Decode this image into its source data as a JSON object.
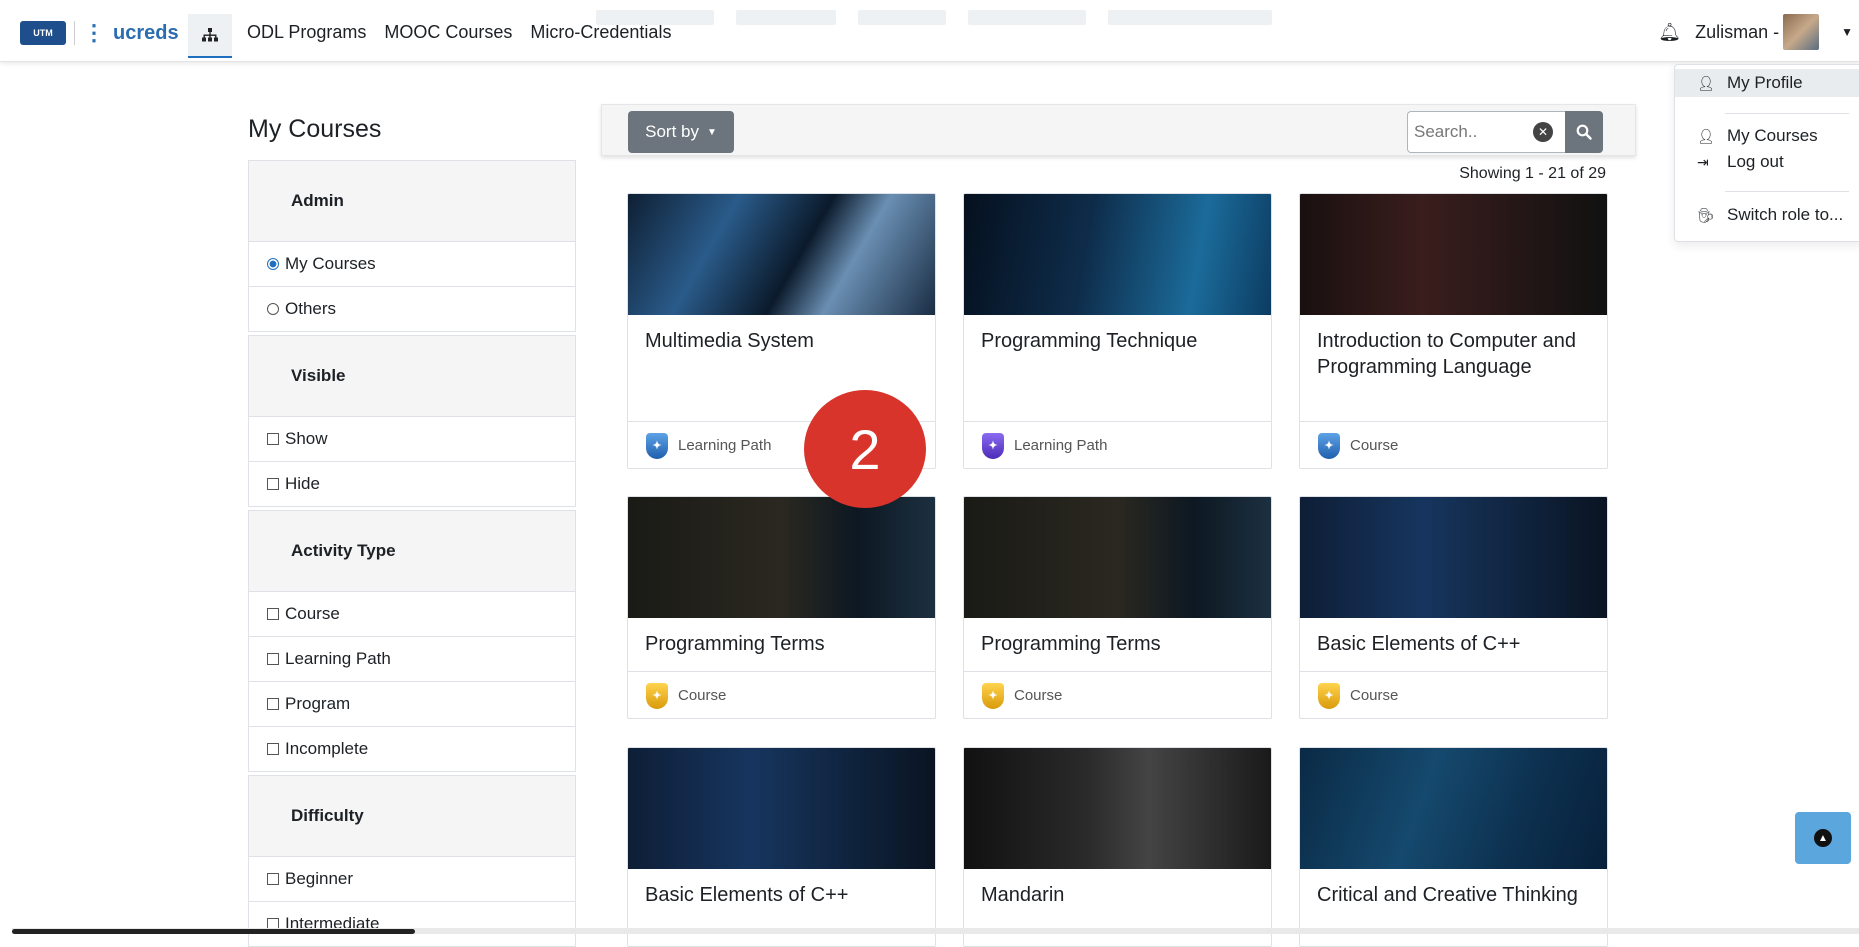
{
  "brand": {
    "badge": "UTM",
    "name": "ucreds"
  },
  "nav": {
    "links": [
      "ODL Programs",
      "MOOC Courses",
      "Micro-Credentials"
    ]
  },
  "user": {
    "name": "Zulisman -"
  },
  "user_menu": {
    "items": [
      {
        "label": "My Profile",
        "icon": "user-icon"
      },
      {
        "label": "My Courses",
        "icon": "user-icon"
      },
      {
        "label": "Log out",
        "icon": "sign-out-icon"
      },
      {
        "label": "Switch role to...",
        "icon": "user-secret-icon"
      }
    ]
  },
  "page": {
    "title": "My Courses"
  },
  "filters": {
    "admin": {
      "title": "Admin",
      "options": [
        "My Courses",
        "Others"
      ]
    },
    "visible": {
      "title": "Visible",
      "options": [
        "Show",
        "Hide"
      ]
    },
    "activity": {
      "title": "Activity Type",
      "options": [
        "Course",
        "Learning Path",
        "Program",
        "Incomplete"
      ]
    },
    "difficulty": {
      "title": "Difficulty",
      "options": [
        "Beginner",
        "Intermediate"
      ]
    }
  },
  "toolbar": {
    "sort_label": "Sort by",
    "search_placeholder": "Search.."
  },
  "results": {
    "showing": "Showing 1 - 21 of 29"
  },
  "courses": [
    {
      "title": "Multimedia System",
      "type": "Learning Path",
      "badge_color": "#1f5fae"
    },
    {
      "title": "Programming Technique",
      "type": "Learning Path",
      "badge_color": "#4b2ab8"
    },
    {
      "title": "Introduction to Computer and Programming Language",
      "type": "Course",
      "badge_color": "#1f5fae"
    },
    {
      "title": "Programming Terms",
      "type": "Course",
      "badge_color": "#d99a0a"
    },
    {
      "title": "Programming Terms",
      "type": "Course",
      "badge_color": "#d99a0a"
    },
    {
      "title": "Basic Elements of C++",
      "type": "Course",
      "badge_color": "#d99a0a"
    },
    {
      "title": "Basic Elements of C++",
      "type": ""
    },
    {
      "title": "Mandarin",
      "type": ""
    },
    {
      "title": "Critical and Creative Thinking",
      "type": ""
    }
  ],
  "step": {
    "number": "2"
  },
  "colors": {
    "accent": "#1f6ec0",
    "step_badge": "#d9342b",
    "sort_button": "#6c757d"
  }
}
